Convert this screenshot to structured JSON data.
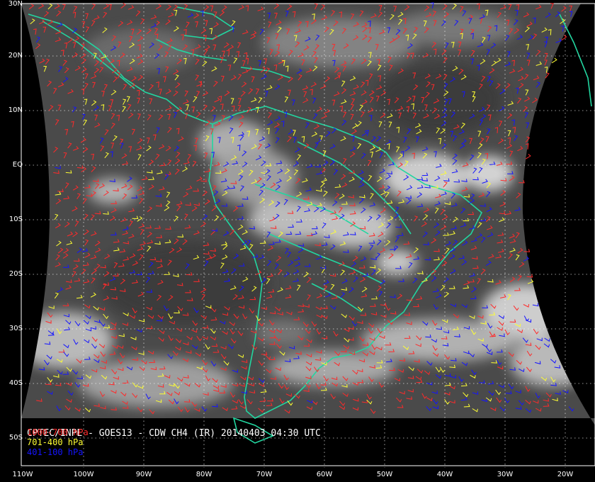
{
  "caption": "CPTEC/INPE - GOES13 - CDW CH4 (IR) 20140403 04:30 UTC",
  "legend": [
    {
      "label": "1000-700 hPa",
      "color": "#ff2a2a"
    },
    {
      "label": "701-400 hPa",
      "color": "#ffff33"
    },
    {
      "label": "401-100 hPa",
      "color": "#1515ff"
    }
  ],
  "colors": {
    "coastline": "#22d6a0",
    "grid": "#ffffff",
    "space": "#000000"
  },
  "lat_labels": [
    "30N",
    "20N",
    "10N",
    "EQ",
    "10S",
    "20S",
    "30S",
    "40S",
    "50S"
  ],
  "lon_labels": [
    "110W",
    "100W",
    "90W",
    "80W",
    "70W",
    "60W",
    "50W",
    "40W",
    "30W",
    "20W"
  ]
}
